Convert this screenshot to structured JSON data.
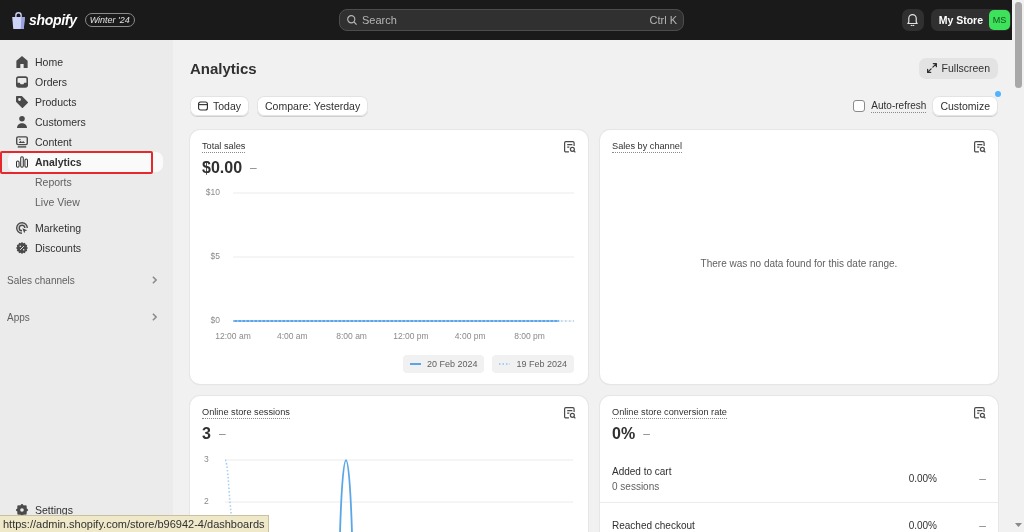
{
  "top_bar": {
    "logo_text": "shopify",
    "edition_badge": "Winter '24",
    "search": {
      "placeholder": "Search",
      "shortcut": "Ctrl K"
    },
    "store_button": {
      "label": "My Store",
      "avatar_initials": "MS"
    }
  },
  "sidebar": {
    "items": [
      {
        "label": "Home",
        "selected": false,
        "highlighted": false
      },
      {
        "label": "Orders",
        "selected": false,
        "highlighted": false
      },
      {
        "label": "Products",
        "selected": false,
        "highlighted": false
      },
      {
        "label": "Customers",
        "selected": false,
        "highlighted": false
      },
      {
        "label": "Content",
        "selected": false,
        "highlighted": false
      },
      {
        "label": "Analytics",
        "selected": true,
        "highlighted": true,
        "children": [
          {
            "label": "Reports",
            "selected": false
          },
          {
            "label": "Live View",
            "selected": false
          }
        ]
      },
      {
        "label": "Marketing",
        "selected": false,
        "highlighted": false
      },
      {
        "label": "Discounts",
        "selected": false,
        "highlighted": false
      }
    ],
    "sections": [
      {
        "label": "Sales channels"
      },
      {
        "label": "Apps"
      }
    ],
    "settings": {
      "label": "Settings"
    }
  },
  "page": {
    "title": "Analytics",
    "fullscreen_button": "Fullscreen",
    "date_button": "Today",
    "compare_button": "Compare: Yesterday",
    "auto_refresh": {
      "label": "Auto-refresh",
      "checked": false
    },
    "customize_button": {
      "label": "Customize",
      "notification_dot": true
    }
  },
  "cards": [
    {
      "kind": "line_chart",
      "title": "Total sales",
      "value": "$0.00",
      "change": "–",
      "chart_data": {
        "type": "line",
        "x": [
          0,
          1,
          2,
          3,
          4,
          5,
          6,
          7,
          8,
          9,
          10,
          11,
          12,
          13,
          14,
          15,
          16,
          17,
          18,
          19,
          20,
          21,
          22,
          23
        ],
        "xlim": [
          0,
          23
        ],
        "xticks": [
          {
            "value": 0,
            "label": "12:00 am"
          },
          {
            "value": 4,
            "label": "4:00 am"
          },
          {
            "value": 8,
            "label": "8:00 am"
          },
          {
            "value": 12,
            "label": "12:00 pm"
          },
          {
            "value": 16,
            "label": "4:00 pm"
          },
          {
            "value": 20,
            "label": "8:00 pm"
          }
        ],
        "ylim": [
          0,
          10
        ],
        "yticks": [
          {
            "value": 0,
            "label": "$0"
          },
          {
            "value": 5,
            "label": "$5"
          },
          {
            "value": 10,
            "label": "$10"
          }
        ],
        "legend": "bottom-right",
        "series": [
          {
            "name": "20 Feb 2024",
            "color": "#5aa6e8",
            "line_style": "solid",
            "values": [
              0,
              0,
              0,
              0,
              0,
              0,
              0,
              0,
              0,
              0,
              0,
              0,
              0,
              0,
              0,
              0,
              0,
              0,
              0,
              0,
              0,
              0,
              0,
              null
            ]
          },
          {
            "name": "19 Feb 2024",
            "color": "#a6cff3",
            "line_style": "dotted",
            "values": [
              0,
              0,
              0,
              0,
              0,
              0,
              0,
              0,
              0,
              0,
              0,
              0,
              0,
              0,
              0,
              0,
              0,
              0,
              0,
              0,
              0,
              0,
              0,
              0
            ]
          }
        ]
      }
    },
    {
      "kind": "message",
      "title": "Sales by channel",
      "message": "There was no data found for this date range."
    },
    {
      "kind": "sessions_chart",
      "title": "Online store sessions",
      "value": "3",
      "change": "–",
      "y_tick_labels": [
        "3",
        "2"
      ]
    },
    {
      "kind": "funnel",
      "title": "Online store conversion rate",
      "value": "0%",
      "change": "–",
      "rows": [
        {
          "label": "Added to cart",
          "detail": "0 sessions",
          "rate": "0.00%",
          "change": "–"
        },
        {
          "label": "Reached checkout",
          "rate": "0.00%",
          "change": "–"
        }
      ]
    }
  ],
  "status_url": "https://admin.shopify.com/store/b96942-4/dashboards"
}
